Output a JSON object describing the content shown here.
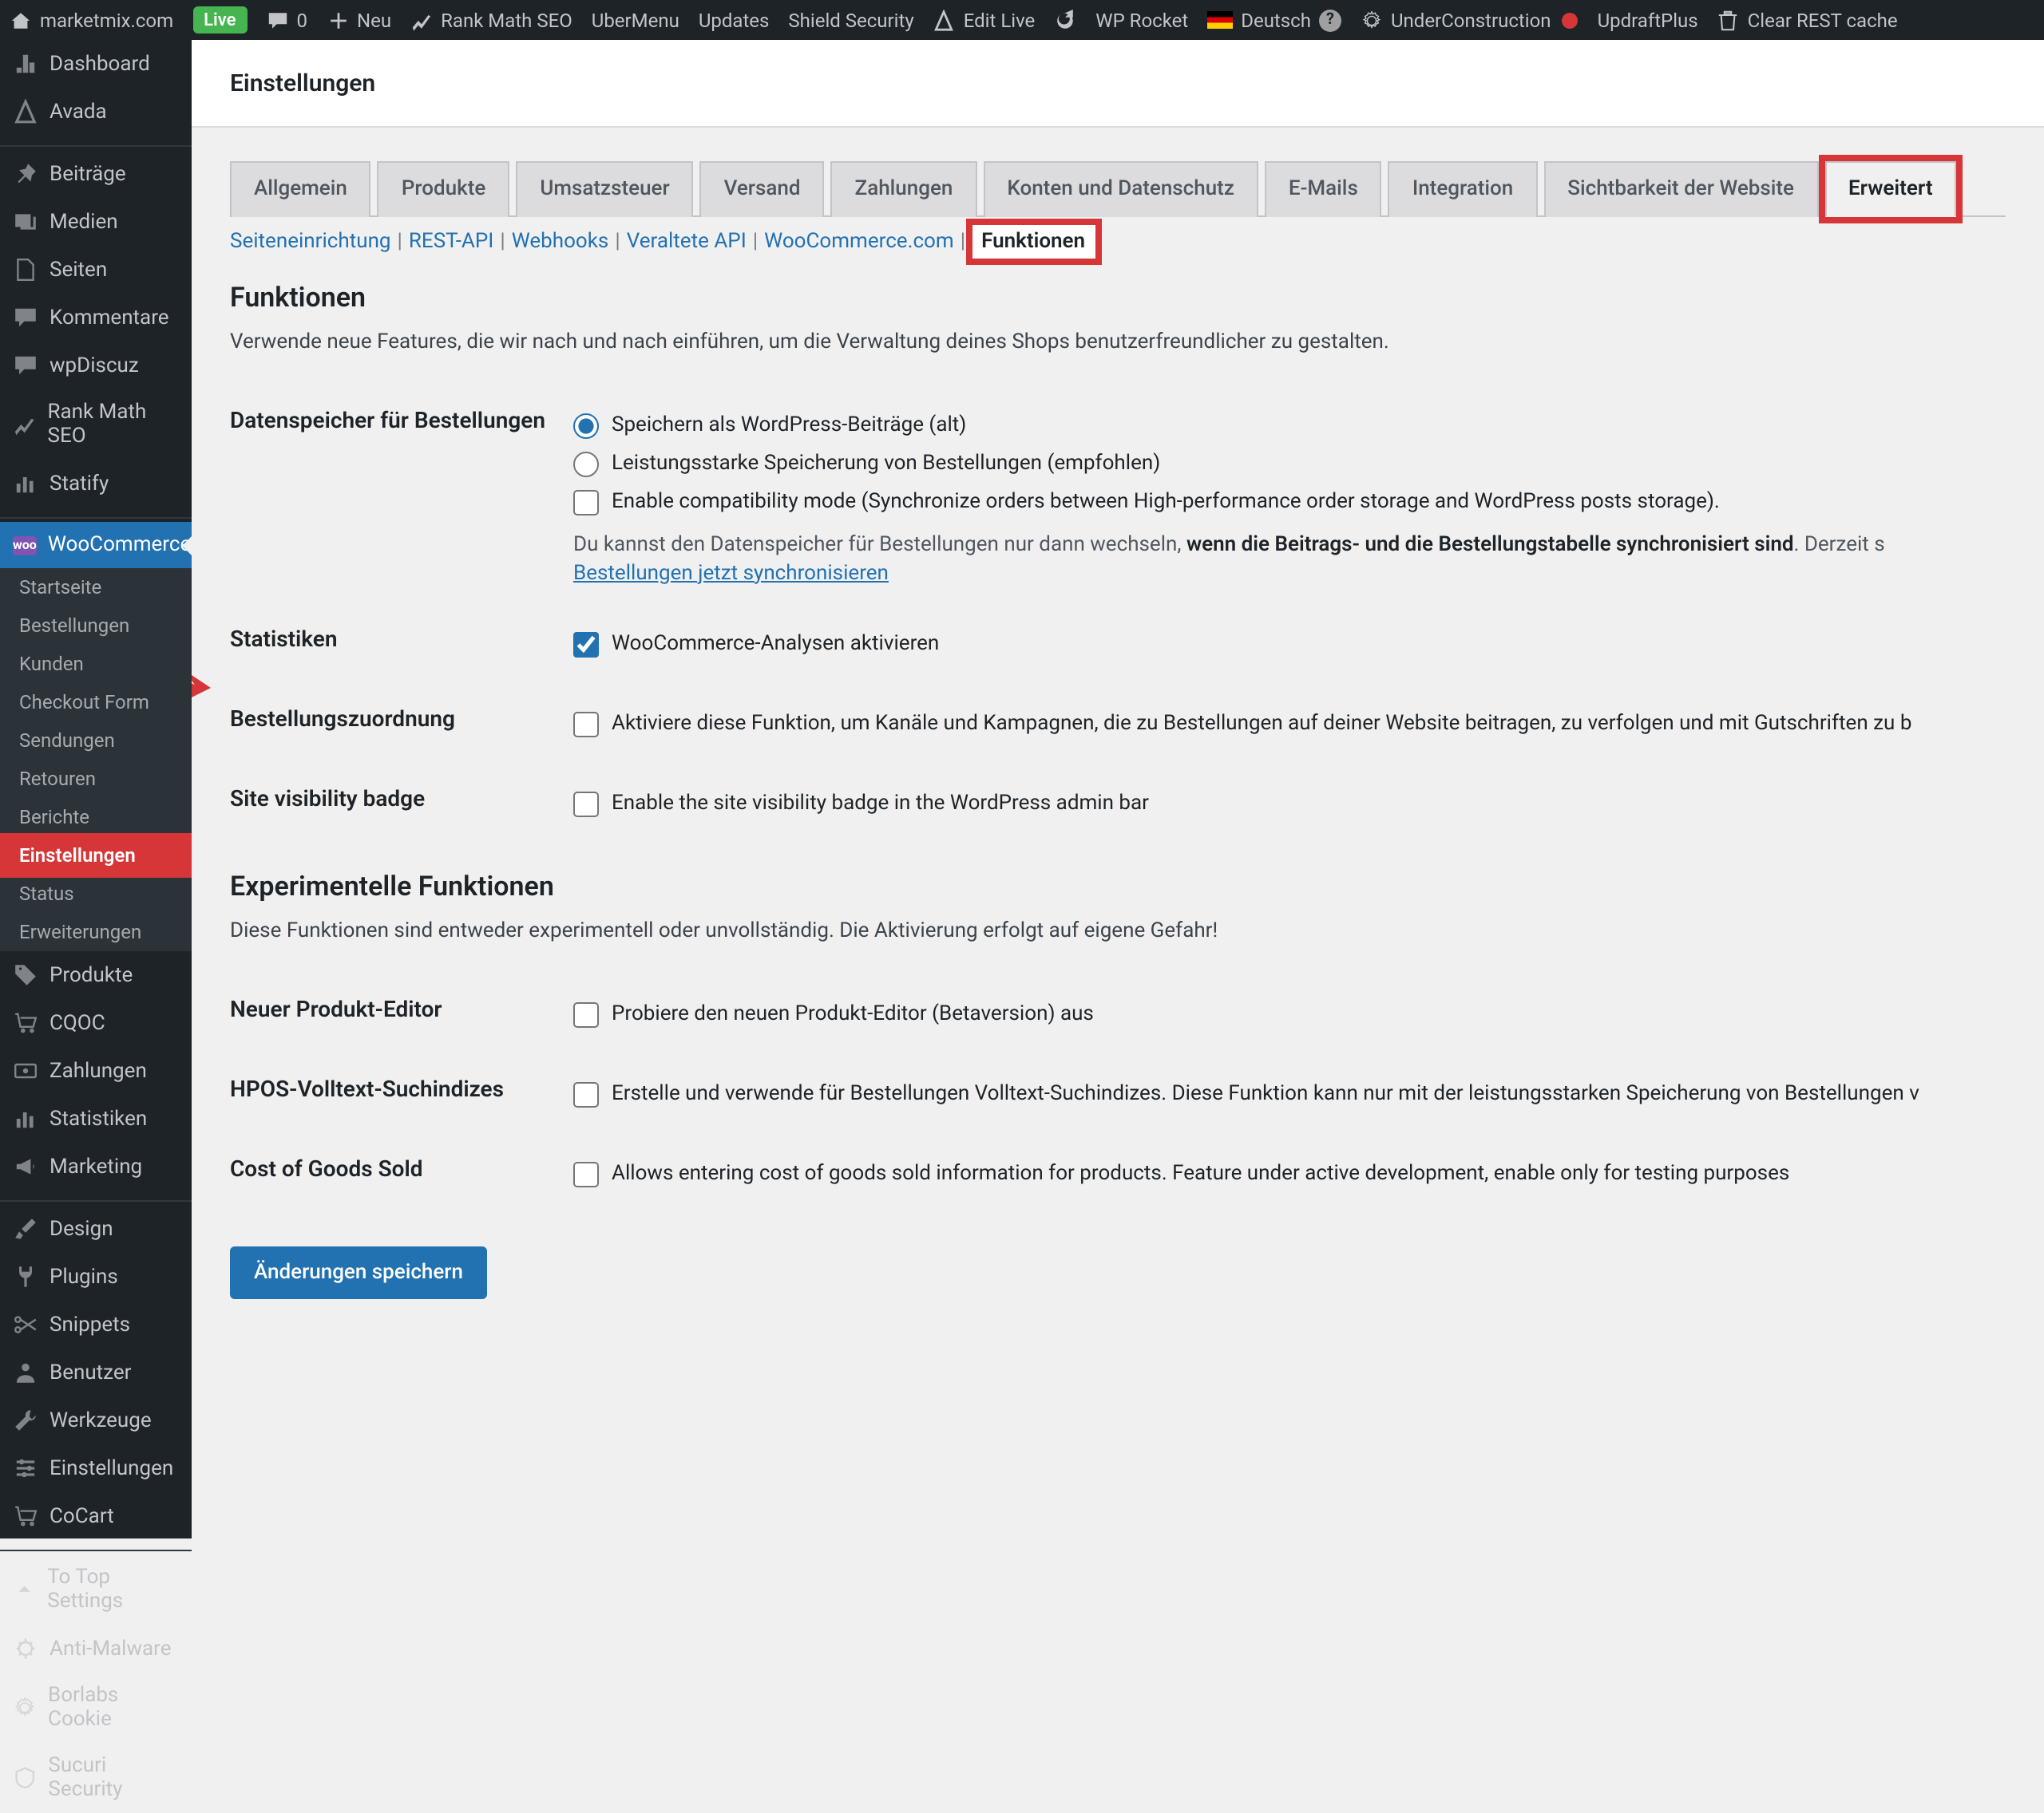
{
  "adminbar": {
    "site": "marketmix.com",
    "live": "Live",
    "comments": "0",
    "neu": "Neu",
    "items": [
      "Rank Math SEO",
      "UberMenu",
      "Updates",
      "Shield Security",
      "Edit Live",
      "",
      "WP Rocket",
      "Deutsch",
      "UnderConstruction",
      "UpdraftPlus",
      "Clear REST cache"
    ]
  },
  "sidebar": {
    "top": [
      {
        "l": "Dashboard",
        "i": "dash"
      },
      {
        "l": "Avada",
        "i": "avada"
      }
    ],
    "g1": [
      {
        "l": "Beiträge",
        "i": "pin"
      },
      {
        "l": "Medien",
        "i": "media"
      },
      {
        "l": "Seiten",
        "i": "page"
      },
      {
        "l": "Kommentare",
        "i": "comment"
      },
      {
        "l": "wpDiscuz",
        "i": "comment"
      },
      {
        "l": "Rank Math SEO",
        "i": "chart"
      },
      {
        "l": "Statify",
        "i": "bars"
      }
    ],
    "woo_label": "WooCommerce",
    "woo_sub": [
      "Startseite",
      "Bestellungen",
      "Kunden",
      "Checkout Form",
      "Sendungen",
      "Retouren",
      "Berichte",
      "Einstellungen",
      "Status",
      "Erweiterungen"
    ],
    "woo_active": "Einstellungen",
    "g2": [
      {
        "l": "Produkte",
        "i": "tag"
      },
      {
        "l": "CQOC",
        "i": "cart"
      },
      {
        "l": "Zahlungen",
        "i": "money"
      },
      {
        "l": "Statistiken",
        "i": "bars"
      },
      {
        "l": "Marketing",
        "i": "mega"
      }
    ],
    "g3": [
      {
        "l": "Design",
        "i": "brush"
      },
      {
        "l": "Plugins",
        "i": "plug"
      },
      {
        "l": "Snippets",
        "i": "scissors"
      },
      {
        "l": "Benutzer",
        "i": "user"
      },
      {
        "l": "Werkzeuge",
        "i": "wrench"
      },
      {
        "l": "Einstellungen",
        "i": "sliders"
      },
      {
        "l": "CoCart",
        "i": "cart"
      }
    ],
    "g4": [
      {
        "l": "To Top Settings",
        "i": "caret"
      },
      {
        "l": "Anti-Malware",
        "i": "bug"
      },
      {
        "l": "Borlabs Cookie",
        "i": "gear"
      },
      {
        "l": "Sucuri Security",
        "i": "shield"
      }
    ]
  },
  "page": {
    "title": "Einstellungen",
    "tabs": [
      "Allgemein",
      "Produkte",
      "Umsatzsteuer",
      "Versand",
      "Zahlungen",
      "Konten und Datenschutz",
      "E-Mails",
      "Integration",
      "Sichtbarkeit der Website",
      "Erweitert"
    ],
    "tab_active": "Erweitert",
    "subtabs": [
      "Seiteneinrichtung",
      "REST-API",
      "Webhooks",
      "Veraltete API",
      "WooCommerce.com",
      "Funktionen"
    ],
    "subtab_active": "Funktionen",
    "h2a": "Funktionen",
    "desc1": "Verwende neue Features, die wir nach und nach einführen, um die Verwaltung deines Shops benutzerfreundlicher zu gestalten.",
    "rows": {
      "datastore": {
        "th": "Datenspeicher für Bestellungen",
        "r1": "Speichern als WordPress-Beiträge (alt)",
        "r2": "Leistungsstarke Speicherung von Bestellungen (empfohlen)",
        "c1": "Enable compatibility mode (Synchronize orders between High-performance order storage and WordPress posts storage).",
        "note_a": "Du kannst den Datenspeicher für Bestellungen nur dann wechseln, ",
        "note_b": "wenn die Beitrags- und die Bestellungstabelle synchronisiert sind",
        "note_c": ". Derzeit s",
        "link": "Bestellungen jetzt synchronisieren"
      },
      "stats": {
        "th": "Statistiken",
        "c": "WooCommerce-Analysen aktivieren"
      },
      "attr": {
        "th": "Bestellungszuordnung",
        "c": "Aktiviere diese Funktion, um Kanäle und Kampagnen, die zu Bestellungen auf deiner Website beitragen, zu verfolgen und mit Gutschriften zu b"
      },
      "vis": {
        "th": "Site visibility badge",
        "c": "Enable the site visibility badge in the WordPress admin bar"
      }
    },
    "h2b": "Experimentelle Funktionen",
    "desc2": "Diese Funktionen sind entweder experimentell oder unvollständig. Die Aktivierung erfolgt auf eigene Gefahr!",
    "rows2": {
      "npe": {
        "th": "Neuer Produkt-Editor",
        "c": "Probiere den neuen Produkt-Editor (Betaversion) aus"
      },
      "hpos": {
        "th": "HPOS-Volltext-Suchindizes",
        "c": "Erstelle und verwende für Bestellungen Volltext-Suchindizes. Diese Funktion kann nur mit der leistungsstarken Speicherung von Bestellungen v"
      },
      "cogs": {
        "th": "Cost of Goods Sold",
        "c": "Allows entering cost of goods sold information for products. Feature under active development, enable only for testing purposes"
      }
    },
    "save": "Änderungen speichern"
  }
}
